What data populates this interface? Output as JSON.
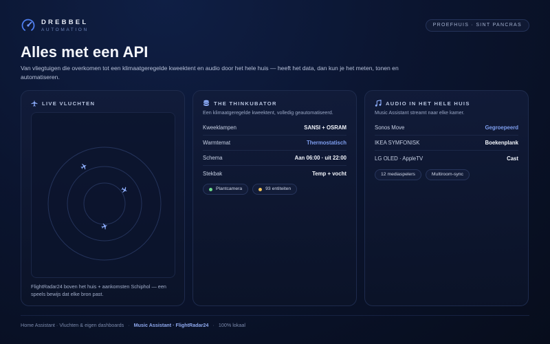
{
  "brand": {
    "name": "DREBBEL",
    "sub": "AUTOMATION",
    "logo": "gauge-logo-icon"
  },
  "location": "PROEFHUIS · SINT PANCRAS",
  "headline": "Alles met een API",
  "subtitle": "Van vliegtuigen die overkomen tot een klimaatgeregelde kweektent en audio door het hele huis — heeft het data, dan kun je het meten, tonen en automatiseren.",
  "colors": {
    "accent": "#7f9ff0",
    "plant_dot": "#6fdc8c",
    "entity_dot": "#f0c35a",
    "bg": "#0b1530"
  },
  "flights": {
    "title": "LIVE VLUCHTEN",
    "icon": "airplane-icon",
    "caption": "FlightRadar24 boven het huis + aankomsten Schiphol — een speels bewijs dat elke bron past.",
    "planes": [
      "plane-icon",
      "plane-icon",
      "plane-icon"
    ]
  },
  "thinkubator": {
    "title": "THE THINKUBATOR",
    "icon": "database-icon",
    "desc": "Een klimaatgeregelde kweektent, volledig geautomatiseerd.",
    "rows": [
      {
        "k": "Kweeklampen",
        "v": "SANSI + OSRAM"
      },
      {
        "k": "Warmtemat",
        "v": "Thermostatisch"
      },
      {
        "k": "Schema",
        "v": "Aan 06:00 · uit 22:00"
      },
      {
        "k": "Stekbak",
        "v": "Temp + vocht"
      }
    ],
    "chips": [
      "Plantcamera",
      "93 entiteiten"
    ]
  },
  "audio": {
    "title": "AUDIO IN HET HELE HUIS",
    "icon": "music-note-icon",
    "desc": "Music Assistant streamt naar elke kamer.",
    "rows": [
      {
        "k": "Sonos Move",
        "v": "Gegroepeerd"
      },
      {
        "k": "IKEA SYMFONISK",
        "v": "Boekenplank"
      },
      {
        "k": "LG OLED · AppleTV",
        "v": "Cast"
      }
    ],
    "chips": [
      "12 mediaspelers",
      "Multiroom-sync"
    ]
  },
  "footer": {
    "left": "Home Assistant · Vluchten & eigen dashboards",
    "mid": "Music Assistant · FlightRadar24",
    "right": "100% lokaal"
  }
}
